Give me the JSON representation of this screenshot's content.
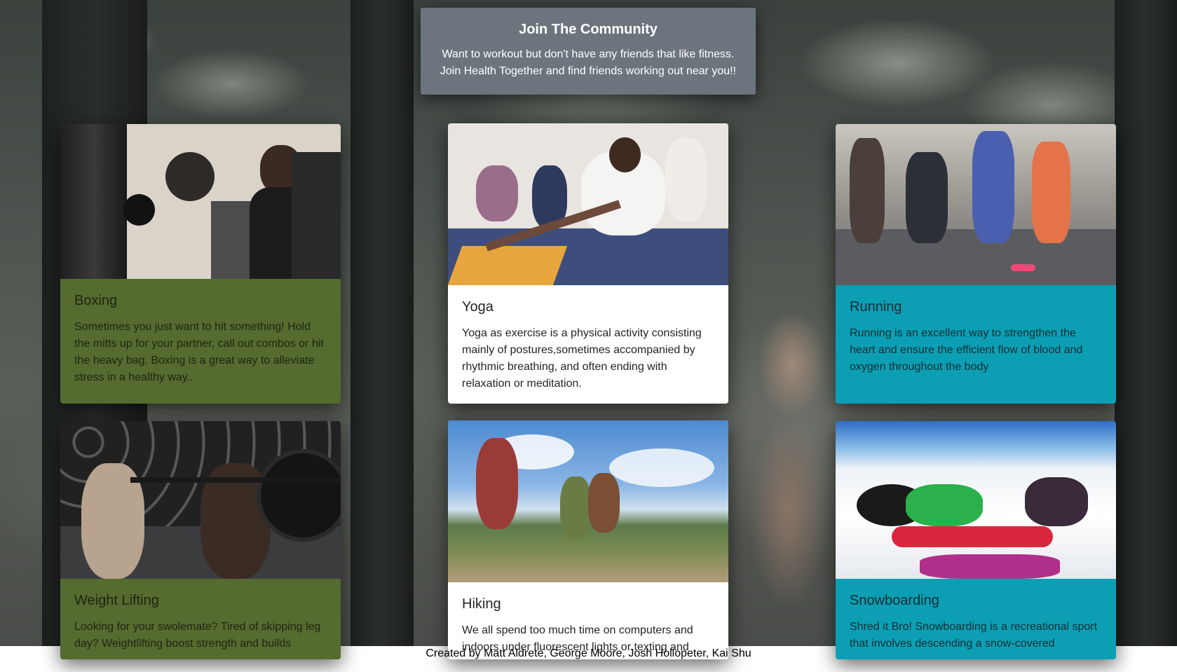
{
  "jumbotron": {
    "title": "Join The Community",
    "line1": "Want to workout but don't have any friends that like fitness.",
    "line2": "Join Health Together and find friends working out near you!!"
  },
  "cards": [
    {
      "title": "Boxing",
      "text": "Sometimes you just want to hit something! Hold the mitts up for your partner, call out combos or hit the heavy bag. Boxing is a great way to alleviate stress in a healthy way.."
    },
    {
      "title": "Yoga",
      "text": "Yoga as exercise is a physical activity consisting mainly of postures,sometimes accompanied by rhythmic breathing, and often ending with relaxation or meditation."
    },
    {
      "title": "Running",
      "text": "Running is an excellent way to strengthen the heart and ensure the efficient flow of blood and oxygen throughout the body"
    },
    {
      "title": "Weight Lifting",
      "text": "Looking for your swolemate? Tired of skipping leg day? Weightlifting boost strength and builds"
    },
    {
      "title": "Hiking",
      "text": "We all spend too much time on computers and indoors under fluorescent lights or texting and"
    },
    {
      "title": "Snowboarding",
      "text": "Shred it Bro! Snowboarding is a recreational sport that involves descending a snow-covered"
    }
  ],
  "footer": {
    "credits": "Created by Matt Aldrete, George Moore, Josh Hollopeter, Kai Shu"
  },
  "colors": {
    "green_card": "#556b2f",
    "teal_card": "#0c9fb4",
    "jumbotron": "#6c757d"
  }
}
